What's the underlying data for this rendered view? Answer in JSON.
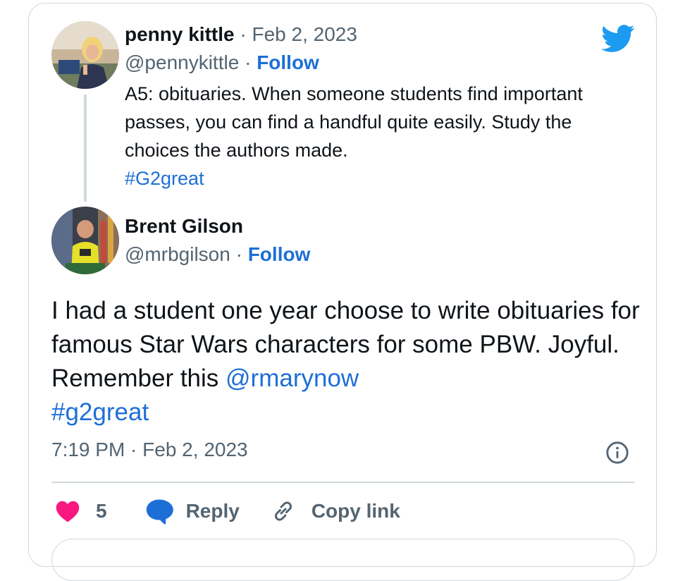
{
  "quoted_tweet": {
    "author_name": "penny kittle",
    "separator": "·",
    "date": "Feb 2, 2023",
    "handle": "@pennykittle",
    "follow_label": "Follow",
    "text": "A5: obituaries. When someone students find important passes, you can find a handful quite easily. Study the choices the authors made.",
    "hashtag": "#G2great"
  },
  "main_tweet": {
    "author_name": "Brent Gilson",
    "handle": "@mrbgilson",
    "separator": "·",
    "follow_label": "Follow",
    "text": "I had a student one year choose to write obituaries for famous Star Wars characters for some PBW. Joyful. Remember this",
    "mention": "@rmarynow",
    "hashtag": "#g2great",
    "timestamp": "7:19 PM · Feb 2, 2023"
  },
  "actions": {
    "like_count": "5",
    "reply_label": "Reply",
    "copy_link_label": "Copy link"
  },
  "colors": {
    "accent": "#1d6fd6",
    "twitter_blue": "#1d9bf0",
    "like_pink": "#f91880",
    "muted": "#536471",
    "border": "#cfd9de"
  },
  "icons": {
    "brand": "twitter-bird-icon",
    "info": "info-icon",
    "like": "heart-icon",
    "reply": "speech-bubble-icon",
    "copy": "link-icon"
  }
}
